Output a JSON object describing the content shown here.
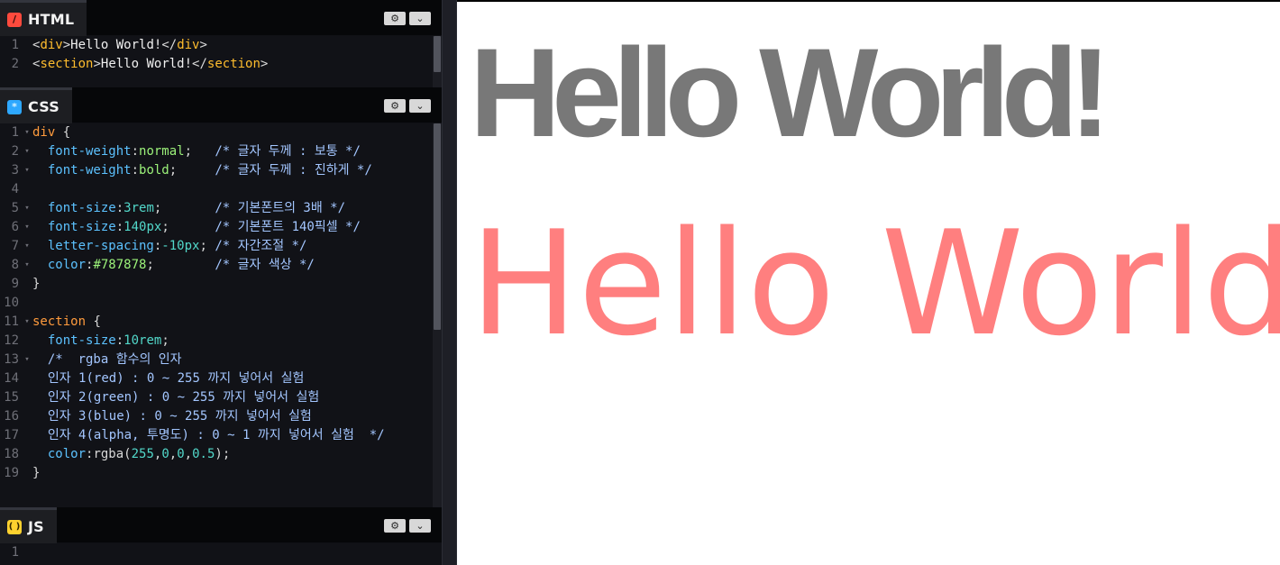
{
  "panels": {
    "html": {
      "title": "HTML",
      "icon": "html-icon",
      "settings_icon": "⚙",
      "collapse_icon": "⌄",
      "lines": [
        {
          "num": "1",
          "fold": "",
          "tokens": [
            {
              "text": "<",
              "kind": "punct"
            },
            {
              "text": "div",
              "kind": "tag"
            },
            {
              "text": ">",
              "kind": "punct"
            },
            {
              "text": "Hello World!",
              "kind": "text"
            },
            {
              "text": "</",
              "kind": "punct"
            },
            {
              "text": "div",
              "kind": "tag"
            },
            {
              "text": ">",
              "kind": "punct"
            }
          ]
        },
        {
          "num": "2",
          "fold": "",
          "tokens": [
            {
              "text": "<",
              "kind": "punct"
            },
            {
              "text": "section",
              "kind": "tag"
            },
            {
              "text": ">",
              "kind": "punct"
            },
            {
              "text": "Hello World!",
              "kind": "text"
            },
            {
              "text": "</",
              "kind": "punct"
            },
            {
              "text": "section",
              "kind": "tag"
            },
            {
              "text": ">",
              "kind": "punct"
            }
          ]
        }
      ]
    },
    "css": {
      "title": "CSS",
      "icon": "css-icon",
      "settings_icon": "⚙",
      "collapse_icon": "⌄",
      "lines": [
        {
          "num": "1",
          "fold": "▾",
          "tokens": [
            {
              "text": "div",
              "kind": "selector"
            },
            {
              "text": " {",
              "kind": "punct"
            }
          ]
        },
        {
          "num": "2",
          "fold": "▾",
          "tokens": [
            {
              "text": "  font-weight",
              "kind": "prop"
            },
            {
              "text": ":",
              "kind": "punct"
            },
            {
              "text": "normal",
              "kind": "value"
            },
            {
              "text": ";   ",
              "kind": "punct"
            },
            {
              "text": "/* 글자 두께 : 보통 */",
              "kind": "comment"
            }
          ]
        },
        {
          "num": "3",
          "fold": "▾",
          "tokens": [
            {
              "text": "  font-weight",
              "kind": "prop"
            },
            {
              "text": ":",
              "kind": "punct"
            },
            {
              "text": "bold",
              "kind": "value"
            },
            {
              "text": ";     ",
              "kind": "punct"
            },
            {
              "text": "/* 글자 두께 : 진하게 */",
              "kind": "comment"
            }
          ]
        },
        {
          "num": "4",
          "fold": "",
          "tokens": []
        },
        {
          "num": "5",
          "fold": "▾",
          "tokens": [
            {
              "text": "  font-size",
              "kind": "prop"
            },
            {
              "text": ":",
              "kind": "punct"
            },
            {
              "text": "3rem",
              "kind": "number"
            },
            {
              "text": ";       ",
              "kind": "punct"
            },
            {
              "text": "/* 기본폰트의 3배 */",
              "kind": "comment"
            }
          ]
        },
        {
          "num": "6",
          "fold": "▾",
          "tokens": [
            {
              "text": "  font-size",
              "kind": "prop"
            },
            {
              "text": ":",
              "kind": "punct"
            },
            {
              "text": "140px",
              "kind": "number"
            },
            {
              "text": ";      ",
              "kind": "punct"
            },
            {
              "text": "/* 기본폰트 140픽셀 */",
              "kind": "comment"
            }
          ]
        },
        {
          "num": "7",
          "fold": "▾",
          "tokens": [
            {
              "text": "  letter-spacing",
              "kind": "prop"
            },
            {
              "text": ":",
              "kind": "punct"
            },
            {
              "text": "-10px",
              "kind": "number"
            },
            {
              "text": "; ",
              "kind": "punct"
            },
            {
              "text": "/* 자간조절 */",
              "kind": "comment"
            }
          ]
        },
        {
          "num": "8",
          "fold": "▾",
          "tokens": [
            {
              "text": "  color",
              "kind": "prop"
            },
            {
              "text": ":",
              "kind": "punct"
            },
            {
              "text": "#787878",
              "kind": "value"
            },
            {
              "text": ";        ",
              "kind": "punct"
            },
            {
              "text": "/* 글자 색상 */",
              "kind": "comment"
            }
          ]
        },
        {
          "num": "9",
          "fold": "",
          "tokens": [
            {
              "text": "}",
              "kind": "punct"
            }
          ]
        },
        {
          "num": "10",
          "fold": "",
          "tokens": []
        },
        {
          "num": "11",
          "fold": "▾",
          "tokens": [
            {
              "text": "section",
              "kind": "selector"
            },
            {
              "text": " {",
              "kind": "punct"
            }
          ]
        },
        {
          "num": "12",
          "fold": "",
          "tokens": [
            {
              "text": "  font-size",
              "kind": "prop"
            },
            {
              "text": ":",
              "kind": "punct"
            },
            {
              "text": "10rem",
              "kind": "number"
            },
            {
              "text": ";",
              "kind": "punct"
            }
          ]
        },
        {
          "num": "13",
          "fold": "▾",
          "tokens": [
            {
              "text": "  /*  rgba 함수의 인자",
              "kind": "comment"
            }
          ]
        },
        {
          "num": "14",
          "fold": "",
          "tokens": [
            {
              "text": "  인자 1(red) : 0 ~ 255 까지 넣어서 실험",
              "kind": "comment"
            }
          ]
        },
        {
          "num": "15",
          "fold": "",
          "tokens": [
            {
              "text": "  인자 2(green) : 0 ~ 255 까지 넣어서 실험",
              "kind": "comment"
            }
          ]
        },
        {
          "num": "16",
          "fold": "",
          "tokens": [
            {
              "text": "  인자 3(blue) : 0 ~ 255 까지 넣어서 실험",
              "kind": "comment"
            }
          ]
        },
        {
          "num": "17",
          "fold": "",
          "tokens": [
            {
              "text": "  인자 4(alpha, 투명도) : 0 ~ 1 까지 넣어서 실험  */",
              "kind": "comment"
            }
          ]
        },
        {
          "num": "18",
          "fold": "",
          "tokens": [
            {
              "text": "  color",
              "kind": "prop"
            },
            {
              "text": ":",
              "kind": "punct"
            },
            {
              "text": "rgba(",
              "kind": "punct"
            },
            {
              "text": "255",
              "kind": "number"
            },
            {
              "text": ",",
              "kind": "punct"
            },
            {
              "text": "0",
              "kind": "number"
            },
            {
              "text": ",",
              "kind": "punct"
            },
            {
              "text": "0",
              "kind": "number"
            },
            {
              "text": ",",
              "kind": "punct"
            },
            {
              "text": "0.5",
              "kind": "number"
            },
            {
              "text": ");",
              "kind": "punct"
            }
          ]
        },
        {
          "num": "19",
          "fold": "",
          "tokens": [
            {
              "text": "}",
              "kind": "punct"
            }
          ]
        }
      ]
    },
    "js": {
      "title": "JS",
      "icon": "js-icon",
      "settings_icon": "⚙",
      "collapse_icon": "⌄",
      "lines": [
        {
          "num": "1",
          "fold": "",
          "tokens": []
        }
      ]
    }
  },
  "preview": {
    "div_text": "Hello World!",
    "section_text": "Hello World!",
    "div_color": "#787878",
    "section_color": "rgba(255,0,0,0.5)"
  }
}
